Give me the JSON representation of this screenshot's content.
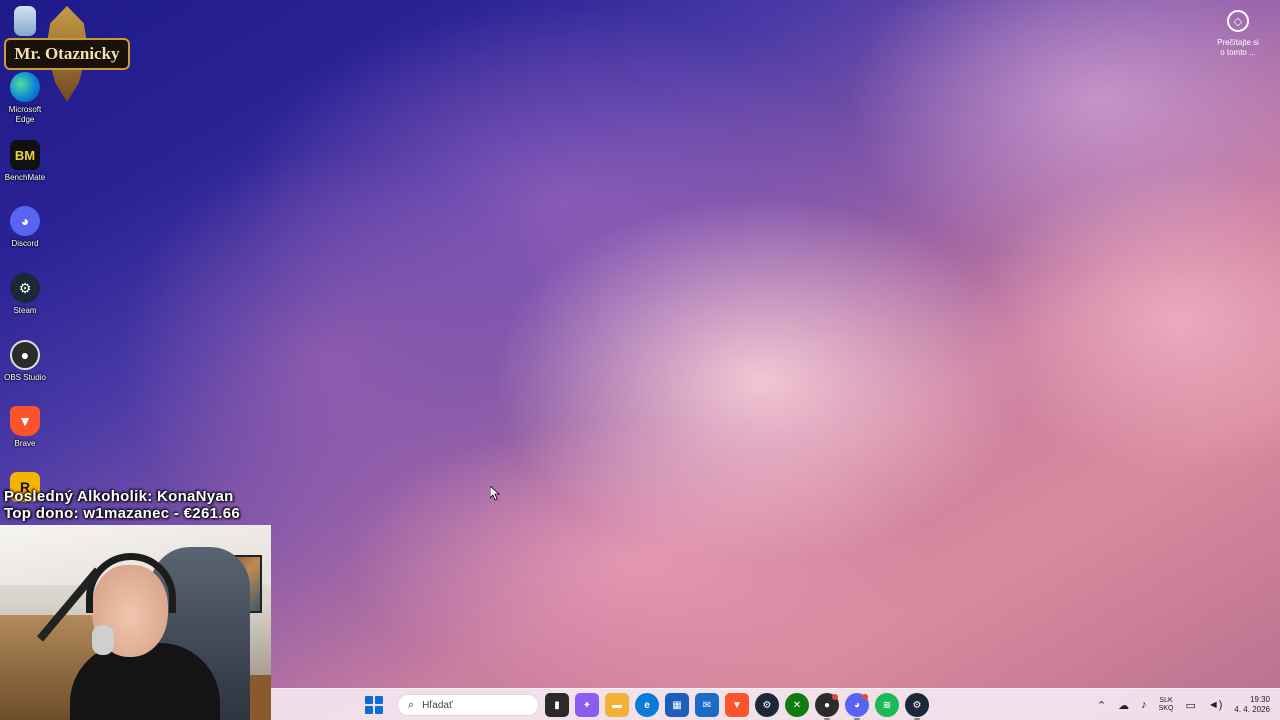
{
  "logo": {
    "text": "Mr. Otaznicky"
  },
  "desktop": {
    "icons": [
      {
        "label": "",
        "glyph": "",
        "icon": "recycle-bin-icon"
      },
      {
        "label": "Microsoft Edge",
        "glyph": "",
        "icon": "edge-icon"
      },
      {
        "label": "BenchMate",
        "glyph": "BM",
        "icon": "benchmate-icon"
      },
      {
        "label": "Discord",
        "glyph": "◕",
        "icon": "discord-icon"
      },
      {
        "label": "Steam",
        "glyph": "⚙",
        "icon": "steam-icon"
      },
      {
        "label": "OBS Studio",
        "glyph": "●",
        "icon": "obs-icon"
      },
      {
        "label": "Brave",
        "glyph": "▼",
        "icon": "brave-icon"
      },
      {
        "label": "",
        "glyph": "R",
        "icon": "rockstar-icon"
      }
    ]
  },
  "corner_widget": {
    "line1": "Prečítajte si",
    "line2": "o tomto ..."
  },
  "overlay": {
    "line1": "Posledný Alkoholik: KonaNyan",
    "line2": "Top dono: w1mazanec - €261.66"
  },
  "taskbar": {
    "search_placeholder": "Hľadať",
    "apps": [
      {
        "name": "taskview",
        "glyph": "▮",
        "bg": "#2a2a2a"
      },
      {
        "name": "copilot",
        "glyph": "✦",
        "bg": "#8a5cf0"
      },
      {
        "name": "file-explorer",
        "glyph": "▬",
        "bg": "#f2b233"
      },
      {
        "name": "edge",
        "glyph": "e",
        "bg": "#0b7bd8"
      },
      {
        "name": "store",
        "glyph": "▦",
        "bg": "#1c5fb8"
      },
      {
        "name": "outlook",
        "glyph": "✉",
        "bg": "#1b6cc6"
      },
      {
        "name": "brave",
        "glyph": "▼",
        "bg": "#fb542b"
      },
      {
        "name": "steam",
        "glyph": "⚙",
        "bg": "#1b2838"
      },
      {
        "name": "xbox",
        "glyph": "✕",
        "bg": "#107c10"
      },
      {
        "name": "obs",
        "glyph": "●",
        "bg": "#2b2b2b"
      },
      {
        "name": "discord",
        "glyph": "◕",
        "bg": "#5865f2"
      },
      {
        "name": "spotify",
        "glyph": "≋",
        "bg": "#1db954"
      },
      {
        "name": "steam-2",
        "glyph": "⚙",
        "bg": "#1b2838"
      }
    ],
    "tray": {
      "lang_line1": "SLK",
      "lang_line2": "SKQ",
      "time": "19:30",
      "date": "4. 4. 2026"
    }
  }
}
